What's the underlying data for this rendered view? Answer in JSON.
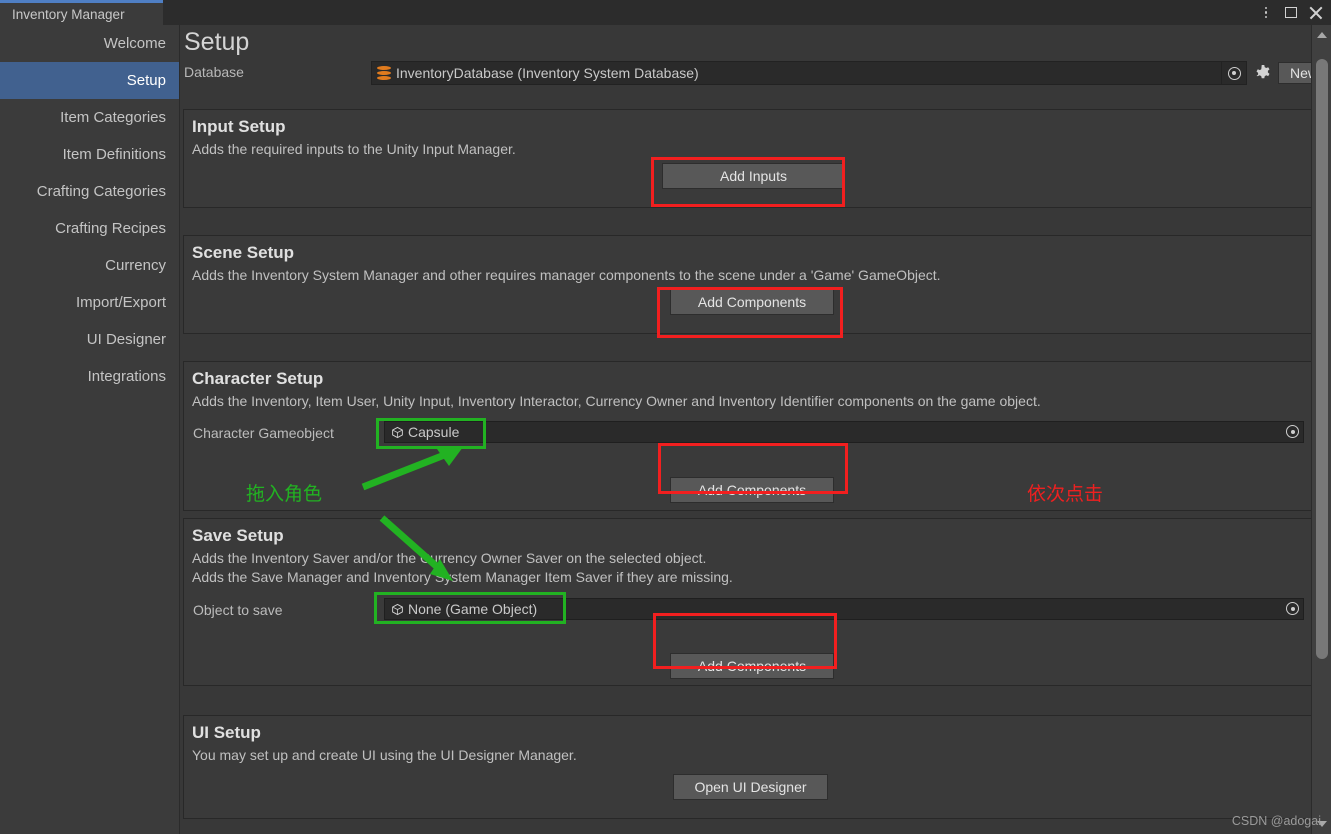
{
  "window": {
    "tab_label": "Inventory Manager",
    "menu_icon": "kebab-menu-icon",
    "maximize_icon": "maximize-icon",
    "close_icon": "close-icon"
  },
  "sidebar": {
    "items": [
      {
        "label": "Welcome",
        "active": false
      },
      {
        "label": "Setup",
        "active": true
      },
      {
        "label": "Item Categories",
        "active": false
      },
      {
        "label": "Item Definitions",
        "active": false
      },
      {
        "label": "Crafting Categories",
        "active": false
      },
      {
        "label": "Crafting Recipes",
        "active": false
      },
      {
        "label": "Currency",
        "active": false
      },
      {
        "label": "Import/Export",
        "active": false
      },
      {
        "label": "UI Designer",
        "active": false
      },
      {
        "label": "Integrations",
        "active": false
      }
    ]
  },
  "main": {
    "title": "Setup",
    "database": {
      "label": "Database",
      "value": "InventoryDatabase (Inventory System Database)",
      "icon": "database-icon",
      "picker_icon": "object-picker-icon",
      "settings_icon": "gear-icon",
      "new_label": "New"
    },
    "sections": [
      {
        "key": "input_setup",
        "title": "Input Setup",
        "desc": "Adds the required inputs to the Unity Input Manager.",
        "button": "Add Inputs"
      },
      {
        "key": "scene_setup",
        "title": "Scene Setup",
        "desc": "Adds the Inventory System Manager and other requires manager components to the scene under a 'Game' GameObject.",
        "button": "Add Components"
      },
      {
        "key": "character_setup",
        "title": "Character Setup",
        "desc": "Adds the Inventory, Item User, Unity Input, Inventory Interactor, Currency Owner and Inventory Identifier components on the game object.",
        "field_label": "Character Gameobject",
        "field_value": "Capsule",
        "field_icon": "prefab-cube-icon",
        "picker_icon": "object-picker-icon",
        "button": "Add Components"
      },
      {
        "key": "save_setup",
        "title": "Save Setup",
        "desc_line1": "Adds the Inventory Saver and/or the Currency Owner Saver on the selected object.",
        "desc_line2": "Adds the Save Manager and Inventory System Manager Item Saver if they are missing.",
        "field_label": "Object to save",
        "field_value": "None (Game Object)",
        "field_icon": "prefab-cube-icon",
        "picker_icon": "object-picker-icon",
        "button": "Add Components"
      },
      {
        "key": "ui_setup",
        "title": "UI Setup",
        "desc": "You may set up and create UI using the UI Designer Manager.",
        "button": "Open UI Designer"
      }
    ]
  },
  "annotations": {
    "drag_character": "拖入角色",
    "click_in_order": "依次点击",
    "green_color": "#22b222",
    "red_color": "#f21f1f"
  },
  "watermark": "CSDN @adogai"
}
